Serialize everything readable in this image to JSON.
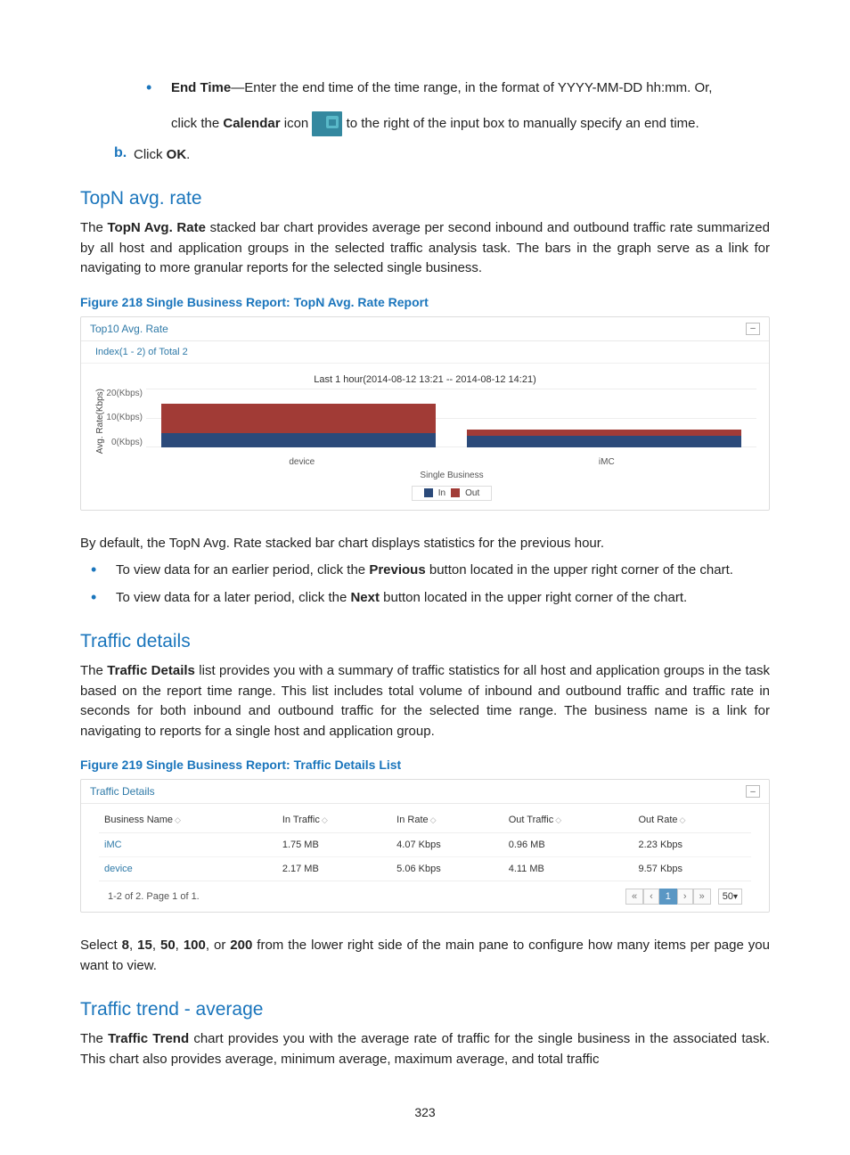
{
  "endtime_bullet": {
    "label": "End Time",
    "sep": "—",
    "line1_rest": "Enter the end time of the time range, in the format of YYYY-MM-DD hh:mm. Or,",
    "line2_pre": "click the ",
    "calendar_word": "Calendar",
    "line2_mid": " icon ",
    "line2_post": " to the right of the input box to manually specify an end time."
  },
  "step_b": {
    "label": "b.",
    "pre": "Click ",
    "ok": "OK",
    "post": "."
  },
  "topn": {
    "heading": "TopN avg. rate",
    "para": {
      "pre": "The ",
      "bold": "TopN Avg. Rate",
      "post": " stacked bar chart provides average per second inbound and outbound traffic rate summarized by all host and application groups in the selected traffic analysis task. The bars in the graph serve as a link for navigating to more granular reports for the selected single business."
    },
    "figcap": "Figure 218 Single Business Report: TopN Avg. Rate Report"
  },
  "chart218": {
    "panel_title": "Top10 Avg. Rate",
    "index_label": "Index(1 - 2) of Total 2",
    "chart_title": "Last 1 hour(2014-08-12 13:21 -- 2014-08-12 14:21)",
    "yaxis_title": "Avg. Rate(Kbps)",
    "yticks": [
      "20(Kbps)",
      "10(Kbps)",
      "0(Kbps)"
    ],
    "xlabels": [
      "device",
      "iMC"
    ],
    "sublabel": "Single Business",
    "legend": {
      "in": "In",
      "out": "Out",
      "in_color": "#2b4a7a",
      "out_color": "#a13b36"
    }
  },
  "chart_data": {
    "type": "bar",
    "title": "Last 1 hour(2014-08-12 13:21 -- 2014-08-12 14:21)",
    "xlabel": "Single Business",
    "ylabel": "Avg. Rate(Kbps)",
    "ylim": [
      0,
      20
    ],
    "categories": [
      "device",
      "iMC"
    ],
    "series": [
      {
        "name": "In",
        "values": [
          5,
          4
        ],
        "color": "#2b4a7a"
      },
      {
        "name": "Out",
        "values": [
          10,
          2
        ],
        "color": "#a13b36"
      }
    ],
    "stacked": true
  },
  "after218": {
    "p1": "By default, the TopN Avg. Rate stacked bar chart displays statistics for the previous hour.",
    "b1_pre": "To view data for an earlier period, click the ",
    "b1_bold": "Previous",
    "b1_post": " button located in the upper right corner of the chart.",
    "b2_pre": "To view data for a later period, click the ",
    "b2_bold": "Next",
    "b2_post": " button located in the upper right corner of the chart."
  },
  "td": {
    "heading": "Traffic details",
    "para_pre": "The ",
    "para_bold": "Traffic Details",
    "para_post": " list provides you with a summary of traffic statistics for all host and application groups in the task based on the report time range. This list includes total volume of inbound and outbound traffic and traffic rate in seconds for both inbound and outbound traffic for the selected time range. The business name is a link for navigating to reports for a single host and application group.",
    "figcap": "Figure 219 Single Business Report: Traffic Details List"
  },
  "table219": {
    "panel_title": "Traffic Details",
    "columns": [
      "Business Name",
      "In Traffic",
      "In Rate",
      "Out Traffic",
      "Out Rate"
    ],
    "rows": [
      {
        "name": "iMC",
        "in_traffic": "1.75 MB",
        "in_rate": "4.07 Kbps",
        "out_traffic": "0.96 MB",
        "out_rate": "2.23 Kbps"
      },
      {
        "name": "device",
        "in_traffic": "2.17 MB",
        "in_rate": "5.06 Kbps",
        "out_traffic": "4.11 MB",
        "out_rate": "9.57 Kbps"
      }
    ],
    "footer_left": "1-2 of 2. Page 1 of 1.",
    "pager": {
      "first": "«",
      "prev": "‹",
      "current": "1",
      "next": "›",
      "last": "»",
      "pagesize": "50"
    }
  },
  "after219": {
    "pre": "Select ",
    "b1": "8",
    "s1": ", ",
    "b2": "15",
    "s2": ", ",
    "b3": "50",
    "s3": ", ",
    "b4": "100",
    "s4": ", or ",
    "b5": "200",
    "post": " from the lower right side of the main pane to configure how many items per page you want to view."
  },
  "trend": {
    "heading": "Traffic trend - average",
    "para_pre": "The ",
    "para_bold": "Traffic Trend",
    "para_post": " chart provides you with the average rate of traffic for the single business in the associated task. This chart also provides average, minimum average, maximum average, and total traffic"
  },
  "icons": {
    "collapse": "–",
    "dropdown": "▾",
    "sort": "◇"
  },
  "pagenum": "323"
}
